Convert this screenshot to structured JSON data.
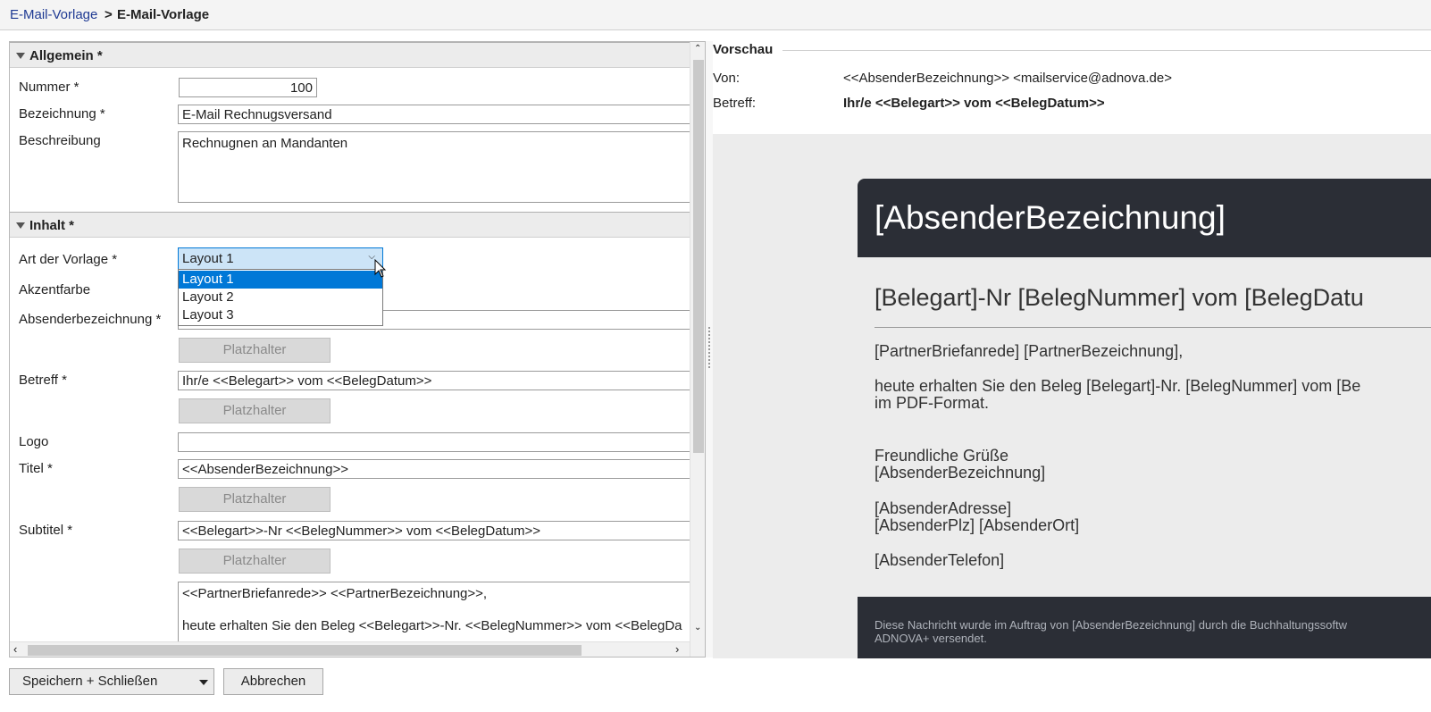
{
  "breadcrumb": {
    "parent": "E-Mail-Vorlage",
    "separator": ">",
    "current": "E-Mail-Vorlage"
  },
  "sections": {
    "general": "Allgemein *",
    "content": "Inhalt *"
  },
  "form": {
    "number": {
      "label": "Nummer *",
      "value": "100"
    },
    "name": {
      "label": "Bezeichnung *",
      "value": "E-Mail Rechnugsversand"
    },
    "description": {
      "label": "Beschreibung",
      "value": "Rechnugnen an Mandanten"
    },
    "template_type": {
      "label": "Art der Vorlage *",
      "value": "Layout 1",
      "options": [
        "Layout 1",
        "Layout 2",
        "Layout 3"
      ],
      "selected_index": 0
    },
    "accent_color": {
      "label": "Akzentfarbe"
    },
    "sender_name": {
      "label": "Absenderbezeichnung *"
    },
    "subject": {
      "label": "Betreff *",
      "value": "Ihr/e <<Belegart>> vom <<BelegDatum>>"
    },
    "logo": {
      "label": "Logo",
      "value": ""
    },
    "title": {
      "label": "Titel *",
      "value": "<<AbsenderBezeichnung>>"
    },
    "subtitle": {
      "label": "Subtitel *",
      "value": "<<Belegart>>-Nr <<BelegNummer>> vom <<BelegDatum>>"
    },
    "body": {
      "line1": "<<PartnerBriefanrede>> <<PartnerBezeichnung>>,",
      "line2": "heute erhalten Sie den Beleg <<Belegart>>-Nr. <<BelegNummer>> vom <<BelegDa"
    },
    "placeholder_button": "Platzhalter"
  },
  "preview": {
    "title": "Vorschau",
    "from_label": "Von:",
    "from_value": "<<AbsenderBezeichnung>> <mailservice@adnova.de>",
    "subject_label": "Betreff:",
    "subject_value": "Ihr/e <<Belegart>> vom <<BelegDatum>>",
    "mail": {
      "header": "[AbsenderBezeichnung]",
      "subtitle": "[Belegart]-Nr [BelegNummer] vom [BelegDatu",
      "greeting": "[PartnerBriefanrede] [PartnerBezeichnung],",
      "text1": "heute erhalten Sie den Beleg [Belegart]-Nr. [BelegNummer] vom [Be",
      "text2": "im PDF-Format.",
      "closing1": "Freundliche Grüße",
      "closing2": "[AbsenderBezeichnung]",
      "addr1": "[AbsenderAdresse]",
      "addr2": "[AbsenderPlz] [AbsenderOrt]",
      "phone": "[AbsenderTelefon]",
      "footer1": "Diese Nachricht wurde im Auftrag von [AbsenderBezeichnung] durch die Buchhaltungssoftw",
      "footer2": "ADNOVA+ versendet."
    }
  },
  "actions": {
    "save": "Speichern + Schließen",
    "cancel": "Abbrechen"
  },
  "colors": {
    "accent": "#0078d7",
    "mail_header": "#2b2e36",
    "link": "#1f3a93"
  }
}
